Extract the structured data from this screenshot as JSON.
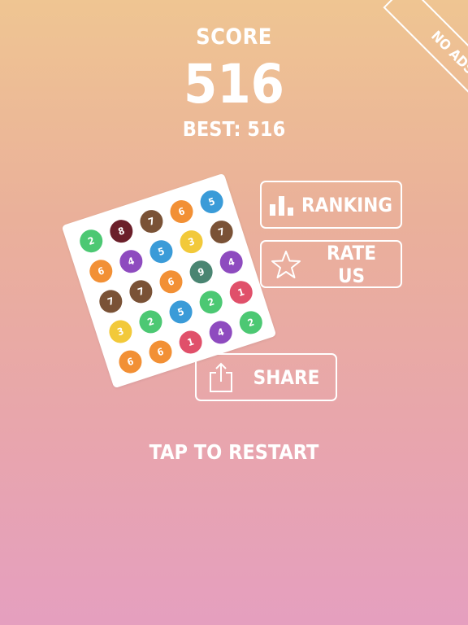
{
  "header": {
    "score_label": "SCORE",
    "score_value": "516",
    "best_line": "BEST: 516"
  },
  "corner_ribbon": {
    "label": "NO ADS"
  },
  "buttons": {
    "ranking": {
      "label": "RANKING",
      "icon": "bar-chart-icon"
    },
    "rate": {
      "label": "RATE US",
      "icon": "star-icon"
    },
    "share": {
      "label": "SHARE",
      "icon": "share-icon"
    }
  },
  "footer": {
    "restart_label": "TAP TO RESTART"
  },
  "colors": {
    "1": "#e0506a",
    "2": "#4cc873",
    "3": "#f2c93a",
    "4": "#8e4bbf",
    "5": "#3a9bd8",
    "6": "#f29035",
    "7": "#7a5236",
    "8": "#6b1f2a",
    "9": "#4a8572"
  },
  "board": {
    "rows": [
      [
        "2",
        "8",
        "7",
        "6",
        "5"
      ],
      [
        "6",
        "4",
        "5",
        "3",
        "7"
      ],
      [
        "7",
        "7",
        "6",
        "9",
        "4"
      ],
      [
        "3",
        "2",
        "5",
        "2",
        "1"
      ],
      [
        "6",
        "6",
        "1",
        "4",
        "2"
      ]
    ]
  }
}
